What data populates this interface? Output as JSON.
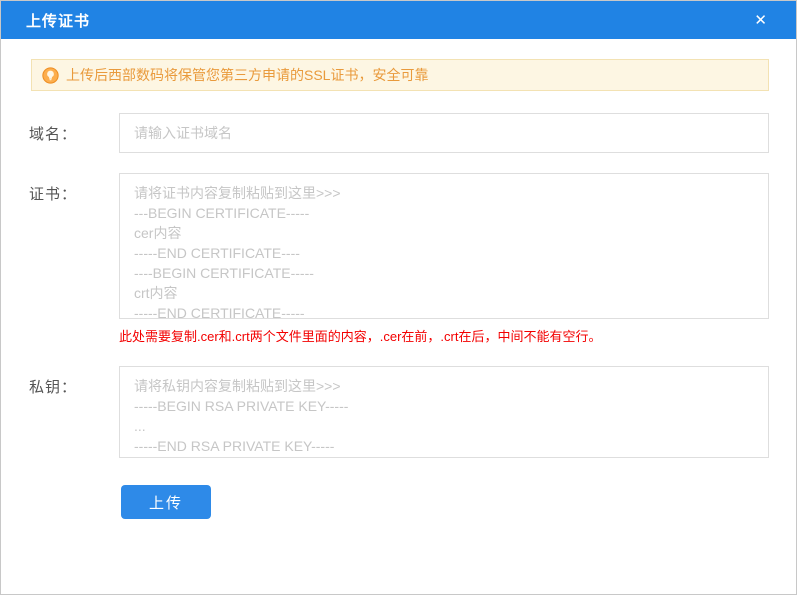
{
  "dialog": {
    "title": "上传证书"
  },
  "icons": {
    "close": "✕",
    "bulb": "lightbulb"
  },
  "banner": {
    "text": "上传后西部数码将保管您第三方申请的SSL证书，安全可靠"
  },
  "form": {
    "domain": {
      "label": "域名：",
      "value": "",
      "placeholder": "请输入证书域名"
    },
    "certificate": {
      "label": "证书：",
      "value": "",
      "placeholder": "请将证书内容复制粘贴到这里>>>\n---BEGIN CERTIFICATE-----\ncer内容\n-----END CERTIFICATE----\n----BEGIN CERTIFICATE-----\ncrt内容\n-----END CERTIFICATE-----",
      "hint": "此处需要复制.cer和.crt两个文件里面的内容，.cer在前，.crt在后，中间不能有空行。"
    },
    "private_key": {
      "label": "私钥：",
      "value": "",
      "placeholder": "请将私钥内容复制粘贴到这里>>>\n-----BEGIN RSA PRIVATE KEY-----\n...\n-----END RSA PRIVATE KEY-----"
    },
    "submit_label": "上传"
  },
  "colors": {
    "header_bg": "#2083e4",
    "button_bg": "#2e8ae8",
    "banner_bg": "#fdf6e3",
    "banner_border": "#f3e2b3",
    "banner_text": "#e99a3c",
    "hint_text": "#f30000",
    "placeholder_text": "#c6c6c6"
  }
}
